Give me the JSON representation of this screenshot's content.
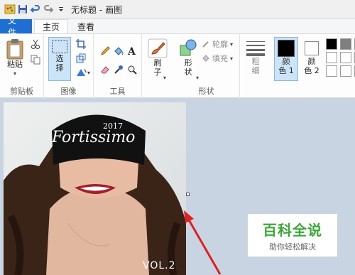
{
  "window": {
    "title": "无标题 - 画图"
  },
  "tabs": {
    "file": "文件",
    "home": "主页",
    "view": "查看"
  },
  "ribbon": {
    "clipboard": {
      "paste": "粘贴",
      "group": "剪贴板"
    },
    "image": {
      "select_line1": "选",
      "select_line2": "择",
      "group": "图像"
    },
    "tools": {
      "group": "工具"
    },
    "brush": {
      "line1": "刷",
      "line2": "子"
    },
    "shapes": {
      "shape_line1": "形",
      "shape_line2": "状",
      "outline": "轮廓",
      "fill": "填充",
      "group": "形状"
    },
    "size": {
      "line1": "粗",
      "line2": "细"
    },
    "color1": {
      "line1": "颜",
      "line2": "色 1"
    },
    "color2": {
      "line1": "颜",
      "line2": "色 2"
    }
  },
  "palette_colors": [
    "#000000",
    "#7f7f7f",
    "#c3c3c3",
    "#ffffff",
    "#ffffff",
    "#c3c3c3",
    "#ffffff",
    "#ffffff",
    "#ffffff"
  ],
  "colors": {
    "color1": "#000000",
    "color2": "#ffffff",
    "accent": "#1e6fd4"
  },
  "canvas": {
    "image_text": {
      "year": "2017",
      "brand": "Fortissimo",
      "vol": "VOL.2"
    }
  },
  "watermark": {
    "title": "百科全说",
    "subtitle": "助你轻松解决"
  }
}
